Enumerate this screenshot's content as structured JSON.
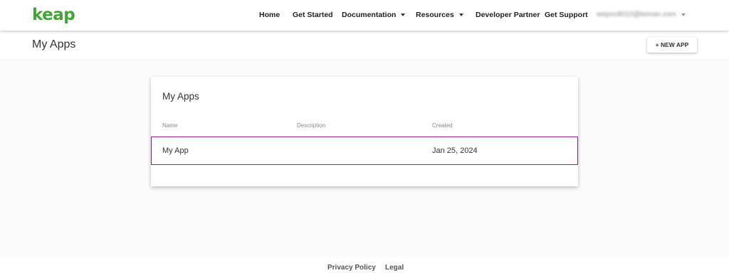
{
  "brand": {
    "logo_text": "keap",
    "color": "#3fa535"
  },
  "nav": {
    "home": "Home",
    "get_started": "Get Started",
    "documentation": "Documentation",
    "resources": "Resources",
    "developer_partner": "Developer Partner",
    "get_support": "Get Support",
    "user_email": "wepoc8010@keivan.com"
  },
  "header": {
    "title": "My Apps",
    "new_app_label": "+ NEW APP"
  },
  "card": {
    "title": "My Apps",
    "columns": [
      "Name",
      "Description",
      "Created"
    ],
    "rows": [
      {
        "name": "My App",
        "description": "",
        "created": "Jan 25, 2024"
      }
    ],
    "selected_row_color": "#8b1e8b"
  },
  "footer": {
    "privacy": "Privacy Policy",
    "legal": "Legal"
  }
}
